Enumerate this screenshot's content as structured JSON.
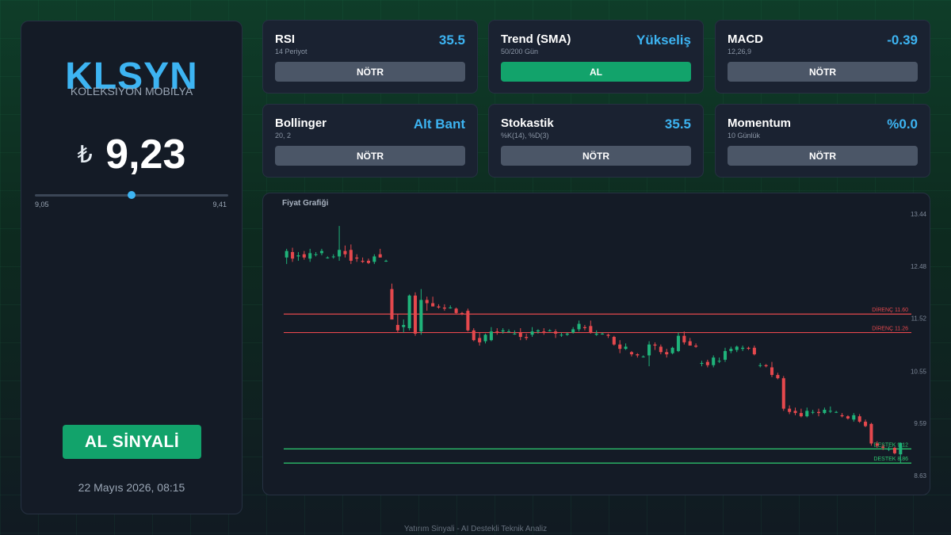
{
  "stock": {
    "ticker": "KLSYN",
    "company": "KOLEKSIYON MOBILYA",
    "currency_symbol": "₺",
    "price": "9,23",
    "price_value": 9.23,
    "range_min": "9,05",
    "range_max": "9,41",
    "range_min_value": 9.05,
    "range_max_value": 9.41,
    "signal_label": "AL SİNYALİ",
    "timestamp": "22 Mayıs 2026, 08:15"
  },
  "indicators": [
    {
      "title": "RSI",
      "subtitle": "14 Periyot",
      "value": "35.5",
      "action": "NÖTR",
      "action_type": "neutral"
    },
    {
      "title": "Trend (SMA)",
      "subtitle": "50/200 Gün",
      "value": "Yükseliş",
      "action": "AL",
      "action_type": "buy"
    },
    {
      "title": "MACD",
      "subtitle": "12,26,9",
      "value": "-0.39",
      "action": "NÖTR",
      "action_type": "neutral"
    },
    {
      "title": "Bollinger",
      "subtitle": "20, 2",
      "value": "Alt Bant",
      "action": "NÖTR",
      "action_type": "neutral"
    },
    {
      "title": "Stokastik",
      "subtitle": "%K(14), %D(3)",
      "value": "35.5",
      "action": "NÖTR",
      "action_type": "neutral"
    },
    {
      "title": "Momentum",
      "subtitle": "10 Günlük",
      "value": "%0.0",
      "action": "NÖTR",
      "action_type": "neutral"
    }
  ],
  "colors": {
    "accent": "#3db4f2",
    "buy": "#12a36b",
    "neutral": "#4b5667",
    "up_candle": "#1fb37a",
    "down_candle": "#e5484d",
    "resistance": "#e5484d",
    "support": "#2ecc71"
  },
  "chart_title": "Fiyat Grafiği",
  "chart_data": {
    "type": "candlestick",
    "y_ticks": [
      "13.44",
      "12.48",
      "11.52",
      "10.55",
      "9.59",
      "8.63"
    ],
    "ylim": [
      8.63,
      13.44
    ],
    "levels": [
      {
        "label": "DİRENÇ 11.60",
        "value": 11.6,
        "kind": "resistance"
      },
      {
        "label": "DİRENÇ 11.26",
        "value": 11.26,
        "kind": "resistance"
      },
      {
        "label": "DESTEK 9.12",
        "value": 9.12,
        "kind": "support"
      },
      {
        "label": "DESTEK 8.86",
        "value": 8.86,
        "kind": "support"
      }
    ],
    "ohlc": [
      {
        "o": 12.64,
        "h": 12.8,
        "l": 12.52,
        "c": 12.76
      },
      {
        "o": 12.74,
        "h": 12.82,
        "l": 12.56,
        "c": 12.62
      },
      {
        "o": 12.66,
        "h": 12.74,
        "l": 12.58,
        "c": 12.68
      },
      {
        "o": 12.7,
        "h": 12.76,
        "l": 12.6,
        "c": 12.64
      },
      {
        "o": 12.62,
        "h": 12.8,
        "l": 12.56,
        "c": 12.72
      },
      {
        "o": 12.7,
        "h": 12.74,
        "l": 12.66,
        "c": 12.7
      },
      {
        "o": 12.72,
        "h": 12.8,
        "l": 12.68,
        "c": 12.76
      },
      {
        "o": 12.64,
        "h": 12.66,
        "l": 12.62,
        "c": 12.64
      },
      {
        "o": 12.66,
        "h": 12.7,
        "l": 12.62,
        "c": 12.66
      },
      {
        "o": 12.66,
        "h": 13.22,
        "l": 12.58,
        "c": 12.78
      },
      {
        "o": 12.76,
        "h": 12.86,
        "l": 12.64,
        "c": 12.7
      },
      {
        "o": 12.78,
        "h": 12.88,
        "l": 12.52,
        "c": 12.58
      },
      {
        "o": 12.64,
        "h": 12.7,
        "l": 12.56,
        "c": 12.62
      },
      {
        "o": 12.58,
        "h": 12.64,
        "l": 12.54,
        "c": 12.56
      },
      {
        "o": 12.58,
        "h": 12.62,
        "l": 12.52,
        "c": 12.54
      },
      {
        "o": 12.56,
        "h": 12.7,
        "l": 12.52,
        "c": 12.66
      },
      {
        "o": 12.7,
        "h": 12.8,
        "l": 12.64,
        "c": 12.64
      },
      {
        "o": 12.58,
        "h": 12.6,
        "l": 12.56,
        "c": 12.58
      },
      {
        "o": 12.06,
        "h": 12.16,
        "l": 11.6,
        "c": 11.5
      },
      {
        "o": 11.4,
        "h": 11.6,
        "l": 11.26,
        "c": 11.3
      },
      {
        "o": 11.36,
        "h": 11.5,
        "l": 11.26,
        "c": 11.4
      },
      {
        "o": 11.34,
        "h": 11.96,
        "l": 11.3,
        "c": 11.94
      },
      {
        "o": 11.94,
        "h": 12.0,
        "l": 11.2,
        "c": 11.24
      },
      {
        "o": 11.28,
        "h": 12.06,
        "l": 11.22,
        "c": 11.86
      },
      {
        "o": 11.86,
        "h": 11.92,
        "l": 11.66,
        "c": 11.8
      },
      {
        "o": 11.8,
        "h": 11.92,
        "l": 11.74,
        "c": 11.74
      },
      {
        "o": 11.74,
        "h": 11.78,
        "l": 11.7,
        "c": 11.72
      },
      {
        "o": 11.72,
        "h": 11.78,
        "l": 11.66,
        "c": 11.7
      },
      {
        "o": 11.72,
        "h": 11.76,
        "l": 11.7,
        "c": 11.72
      },
      {
        "o": 11.7,
        "h": 11.72,
        "l": 11.6,
        "c": 11.62
      },
      {
        "o": 11.62,
        "h": 11.64,
        "l": 11.58,
        "c": 11.6
      },
      {
        "o": 11.66,
        "h": 11.7,
        "l": 11.28,
        "c": 11.3
      },
      {
        "o": 11.3,
        "h": 11.34,
        "l": 11.1,
        "c": 11.12
      },
      {
        "o": 11.16,
        "h": 11.26,
        "l": 11.02,
        "c": 11.08
      },
      {
        "o": 11.1,
        "h": 11.24,
        "l": 11.06,
        "c": 11.22
      },
      {
        "o": 11.12,
        "h": 11.36,
        "l": 11.1,
        "c": 11.28
      },
      {
        "o": 11.28,
        "h": 11.34,
        "l": 11.22,
        "c": 11.26
      },
      {
        "o": 11.28,
        "h": 11.34,
        "l": 11.24,
        "c": 11.3
      },
      {
        "o": 11.28,
        "h": 11.32,
        "l": 11.26,
        "c": 11.28
      },
      {
        "o": 11.24,
        "h": 11.3,
        "l": 11.22,
        "c": 11.24
      },
      {
        "o": 11.26,
        "h": 11.34,
        "l": 11.12,
        "c": 11.18
      },
      {
        "o": 11.18,
        "h": 11.24,
        "l": 11.12,
        "c": 11.16
      },
      {
        "o": 11.22,
        "h": 11.36,
        "l": 11.18,
        "c": 11.28
      },
      {
        "o": 11.28,
        "h": 11.32,
        "l": 11.24,
        "c": 11.3
      },
      {
        "o": 11.28,
        "h": 11.34,
        "l": 11.22,
        "c": 11.26
      },
      {
        "o": 11.3,
        "h": 11.32,
        "l": 11.28,
        "c": 11.3
      },
      {
        "o": 11.28,
        "h": 11.32,
        "l": 11.16,
        "c": 11.24
      },
      {
        "o": 11.22,
        "h": 11.26,
        "l": 11.18,
        "c": 11.22
      },
      {
        "o": 11.22,
        "h": 11.26,
        "l": 11.2,
        "c": 11.24
      },
      {
        "o": 11.26,
        "h": 11.36,
        "l": 11.24,
        "c": 11.32
      },
      {
        "o": 11.32,
        "h": 11.48,
        "l": 11.28,
        "c": 11.42
      },
      {
        "o": 11.36,
        "h": 11.4,
        "l": 11.3,
        "c": 11.34
      },
      {
        "o": 11.38,
        "h": 11.48,
        "l": 11.24,
        "c": 11.26
      },
      {
        "o": 11.22,
        "h": 11.3,
        "l": 11.2,
        "c": 11.24
      },
      {
        "o": 11.24,
        "h": 11.26,
        "l": 11.22,
        "c": 11.24
      },
      {
        "o": 11.22,
        "h": 11.24,
        "l": 11.16,
        "c": 11.2
      },
      {
        "o": 11.18,
        "h": 11.2,
        "l": 11.02,
        "c": 11.04
      },
      {
        "o": 11.04,
        "h": 11.12,
        "l": 10.88,
        "c": 10.96
      },
      {
        "o": 10.96,
        "h": 11.06,
        "l": 10.94,
        "c": 11.0
      },
      {
        "o": 10.9,
        "h": 10.92,
        "l": 10.82,
        "c": 10.86
      },
      {
        "o": 10.86,
        "h": 10.88,
        "l": 10.8,
        "c": 10.84
      },
      {
        "o": 10.82,
        "h": 10.84,
        "l": 10.8,
        "c": 10.82
      },
      {
        "o": 10.84,
        "h": 11.1,
        "l": 10.64,
        "c": 11.04
      },
      {
        "o": 11.04,
        "h": 11.08,
        "l": 10.94,
        "c": 11.02
      },
      {
        "o": 11.0,
        "h": 11.04,
        "l": 10.86,
        "c": 10.9
      },
      {
        "o": 10.9,
        "h": 10.96,
        "l": 10.8,
        "c": 10.86
      },
      {
        "o": 10.88,
        "h": 11.0,
        "l": 10.86,
        "c": 10.98
      },
      {
        "o": 10.92,
        "h": 11.26,
        "l": 10.9,
        "c": 11.2
      },
      {
        "o": 11.2,
        "h": 11.28,
        "l": 11.04,
        "c": 11.08
      },
      {
        "o": 11.1,
        "h": 11.16,
        "l": 11.02,
        "c": 11.02
      },
      {
        "o": 11.02,
        "h": 11.06,
        "l": 10.98,
        "c": 11.0
      },
      {
        "o": 10.7,
        "h": 10.74,
        "l": 10.64,
        "c": 10.7
      },
      {
        "o": 10.72,
        "h": 10.76,
        "l": 10.62,
        "c": 10.66
      },
      {
        "o": 10.66,
        "h": 10.84,
        "l": 10.62,
        "c": 10.8
      },
      {
        "o": 10.74,
        "h": 10.8,
        "l": 10.7,
        "c": 10.74
      },
      {
        "o": 10.76,
        "h": 10.98,
        "l": 10.72,
        "c": 10.92
      },
      {
        "o": 10.92,
        "h": 11.0,
        "l": 10.88,
        "c": 10.96
      },
      {
        "o": 10.94,
        "h": 11.02,
        "l": 10.9,
        "c": 11.0
      },
      {
        "o": 10.96,
        "h": 11.02,
        "l": 10.92,
        "c": 10.98
      },
      {
        "o": 10.98,
        "h": 11.0,
        "l": 10.94,
        "c": 10.96
      },
      {
        "o": 10.98,
        "h": 11.02,
        "l": 10.84,
        "c": 10.86
      },
      {
        "o": 10.66,
        "h": 10.7,
        "l": 10.62,
        "c": 10.66
      },
      {
        "o": 10.66,
        "h": 10.68,
        "l": 10.62,
        "c": 10.64
      },
      {
        "o": 10.62,
        "h": 10.72,
        "l": 10.44,
        "c": 10.48
      },
      {
        "o": 10.48,
        "h": 10.52,
        "l": 10.4,
        "c": 10.42
      },
      {
        "o": 10.42,
        "h": 10.46,
        "l": 9.82,
        "c": 9.86
      },
      {
        "o": 9.86,
        "h": 9.92,
        "l": 9.76,
        "c": 9.8
      },
      {
        "o": 9.82,
        "h": 9.88,
        "l": 9.74,
        "c": 9.78
      },
      {
        "o": 9.78,
        "h": 9.86,
        "l": 9.7,
        "c": 9.72
      },
      {
        "o": 9.72,
        "h": 9.88,
        "l": 9.7,
        "c": 9.82
      },
      {
        "o": 9.8,
        "h": 9.84,
        "l": 9.76,
        "c": 9.8
      },
      {
        "o": 9.8,
        "h": 9.86,
        "l": 9.72,
        "c": 9.78
      },
      {
        "o": 9.78,
        "h": 9.88,
        "l": 9.76,
        "c": 9.84
      },
      {
        "o": 9.82,
        "h": 9.9,
        "l": 9.78,
        "c": 9.82
      },
      {
        "o": 9.8,
        "h": 9.82,
        "l": 9.78,
        "c": 9.8
      },
      {
        "o": 9.74,
        "h": 9.78,
        "l": 9.7,
        "c": 9.72
      },
      {
        "o": 9.72,
        "h": 9.74,
        "l": 9.66,
        "c": 9.68
      },
      {
        "o": 9.66,
        "h": 9.78,
        "l": 9.62,
        "c": 9.74
      },
      {
        "o": 9.72,
        "h": 9.76,
        "l": 9.6,
        "c": 9.62
      },
      {
        "o": 9.62,
        "h": 9.66,
        "l": 9.52,
        "c": 9.54
      },
      {
        "o": 9.58,
        "h": 9.6,
        "l": 9.18,
        "c": 9.22
      },
      {
        "o": 9.22,
        "h": 9.26,
        "l": 9.14,
        "c": 9.18
      },
      {
        "o": 9.16,
        "h": 9.2,
        "l": 9.1,
        "c": 9.14
      },
      {
        "o": 9.12,
        "h": 9.16,
        "l": 9.08,
        "c": 9.12
      },
      {
        "o": 9.14,
        "h": 9.16,
        "l": 9.02,
        "c": 9.04
      },
      {
        "o": 9.02,
        "h": 9.24,
        "l": 8.86,
        "c": 9.23
      }
    ]
  },
  "footer": "Yatırım Sinyali - AI Destekli Teknik Analiz"
}
